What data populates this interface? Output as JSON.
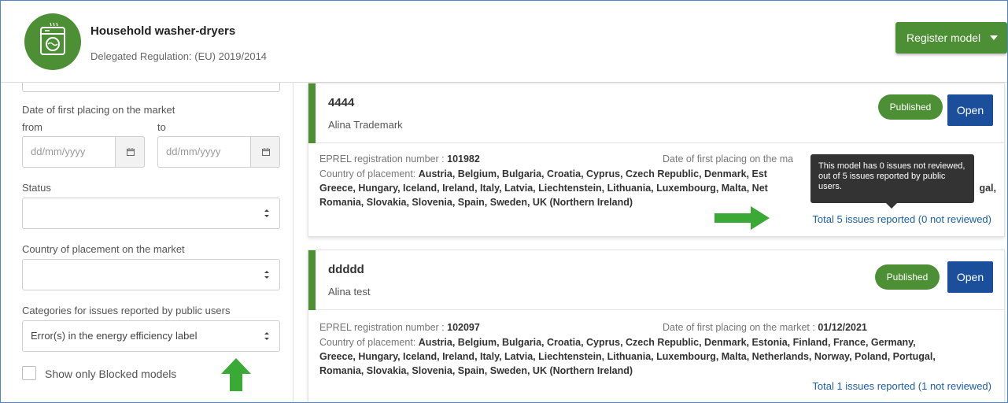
{
  "header": {
    "title": "Household washer-dryers",
    "subtitle": "Delegated Regulation: (EU) 2019/2014",
    "register_label": "Register model",
    "logo_icon": "washer-dryer-icon"
  },
  "sidebar": {
    "date_label": "Date of first placing on the market",
    "from_label": "from",
    "to_label": "to",
    "from_placeholder": "dd/mm/yyyy",
    "to_placeholder": "dd/mm/yyyy",
    "status_label": "Status",
    "status_value": "",
    "country_label": "Country of placement on the market",
    "country_value": "",
    "categories_label": "Categories for issues reported by public users",
    "categories_value": "Error(s) in the energy efficiency label",
    "blocked_label": "Show only Blocked models",
    "blocked_checked": false
  },
  "cards": [
    {
      "model": "4444",
      "brand": "Alina Trademark",
      "status": "Published",
      "open_label": "Open",
      "reg_label": "EPREL registration number :",
      "reg_number": "101982",
      "date_label": "Date of first placing on the ma",
      "date_value": "",
      "country_label": "Country of placement:",
      "countries_line1": "Austria, Belgium, Bulgaria, Croatia, Cyprus, Czech Republic, Denmark, Est",
      "countries_line2": "Greece, Hungary, Iceland, Ireland, Italy, Latvia, Liechtenstein, Lithuania, Luxembourg, Malta, Net",
      "countries_line2_end": "gal,",
      "countries_line3": "Romania, Slovakia, Slovenia, Spain, Sweden, UK (Northern Ireland)",
      "issues": "Total 5 issues reported (0 not reviewed)"
    },
    {
      "model": "ddddd",
      "brand": "Alina test",
      "status": "Published",
      "open_label": "Open",
      "reg_label": "EPREL registration number :",
      "reg_number": "102097",
      "date_label": "Date of first placing on the market :",
      "date_value": "01/12/2021",
      "country_label": "Country of placement:",
      "countries_line1": "Austria, Belgium, Bulgaria, Croatia, Cyprus, Czech Republic, Denmark, Estonia, Finland, France, Germany,",
      "countries_line2": "Greece, Hungary, Iceland, Ireland, Italy, Latvia, Liechtenstein, Lithuania, Luxembourg, Malta, Netherlands, Norway, Poland, Portugal,",
      "countries_line3": "Romania, Slovakia, Slovenia, Spain, Sweden, UK (Northern Ireland)",
      "issues": "Total 1 issues reported (1 not reviewed)"
    }
  ],
  "tooltip": {
    "text": "This model has 0 issues not reviewed, out of 5 issues reported by public users."
  },
  "colors": {
    "brand_green": "#4d8f35",
    "open_blue": "#1b4f9c",
    "link_blue": "#1b5fa8",
    "arrow_green": "#3aa935"
  }
}
